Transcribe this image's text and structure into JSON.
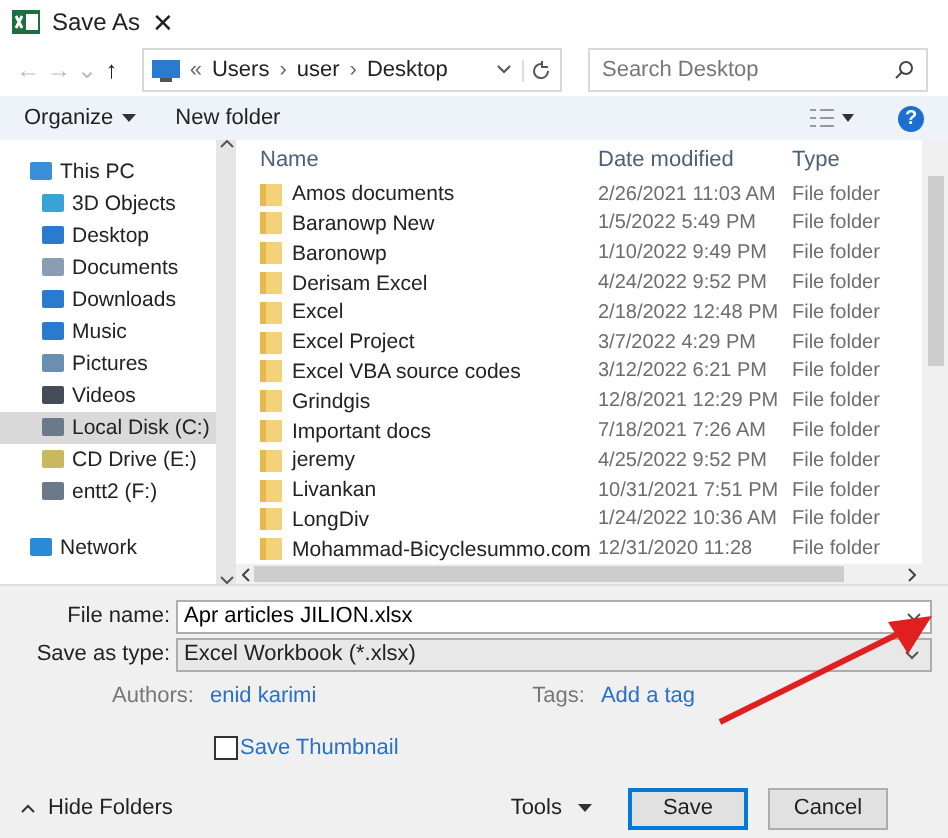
{
  "window": {
    "title": "Save As",
    "close": "✕"
  },
  "nav": {
    "back": "←",
    "forward": "→",
    "recent": "⌄",
    "up": "↑",
    "path_prefix": "«",
    "path": [
      "Users",
      "user",
      "Desktop"
    ],
    "separator": "›",
    "search": {
      "placeholder": "Search Desktop"
    }
  },
  "toolbar": {
    "organize": "Organize",
    "new_folder": "New folder",
    "help": "?"
  },
  "sidebar": {
    "items": [
      {
        "label": "This PC",
        "selected": false,
        "children": [
          {
            "label": "3D Objects",
            "selected": false
          },
          {
            "label": "Desktop",
            "selected": false
          },
          {
            "label": "Documents",
            "selected": false
          },
          {
            "label": "Downloads",
            "selected": false
          },
          {
            "label": "Music",
            "selected": false
          },
          {
            "label": "Pictures",
            "selected": false
          },
          {
            "label": "Videos",
            "selected": false
          },
          {
            "label": "Local Disk (C:)",
            "selected": true
          },
          {
            "label": "CD Drive (E:)",
            "selected": false
          },
          {
            "label": "entt2 (F:)",
            "selected": false
          }
        ]
      },
      {
        "label": "Network",
        "selected": false
      }
    ]
  },
  "table": {
    "columns": [
      "Name",
      "Date modified",
      "Type"
    ],
    "rows": [
      [
        "Amos documents",
        "2/26/2021 11:03 AM",
        "File folder"
      ],
      [
        "Baranowp New",
        "1/5/2022 5:49 PM",
        "File folder"
      ],
      [
        "Baronowp",
        "1/10/2022 9:49 PM",
        "File folder"
      ],
      [
        "Derisam Excel",
        "4/24/2022 9:52 PM",
        "File folder"
      ],
      [
        "Excel",
        "2/18/2022 12:48 PM",
        "File folder"
      ],
      [
        "Excel Project",
        "3/7/2022 4:29 PM",
        "File folder"
      ],
      [
        "Excel VBA source codes",
        "3/12/2022 6:21 PM",
        "File folder"
      ],
      [
        "Grindgis",
        "12/8/2021 12:29 PM",
        "File folder"
      ],
      [
        "Important docs",
        "7/18/2021 7:26 AM",
        "File folder"
      ],
      [
        "jeremy",
        "4/25/2022 9:52 PM",
        "File folder"
      ],
      [
        "Livankan",
        "10/31/2021 7:51 PM",
        "File folder"
      ],
      [
        "LongDiv",
        "1/24/2022 10:36 AM",
        "File folder"
      ],
      [
        "Mohammad-Bicyclesummo.com",
        "12/31/2020 11:28",
        "File folder"
      ]
    ]
  },
  "form": {
    "file_name_label": "File name:",
    "file_name": "Apr articles JILION.xlsx",
    "type_label": "Save as type:",
    "type": "Excel Workbook (*.xlsx)",
    "authors_label": "Authors:",
    "authors": "enid karimi",
    "tags_label": "Tags:",
    "tags": "Add a tag",
    "thumbnail": {
      "label": "Save Thumbnail",
      "checked": false
    }
  },
  "footer": {
    "hide_folders": "Hide Folders",
    "tools": "Tools",
    "save": "Save",
    "cancel": "Cancel"
  }
}
